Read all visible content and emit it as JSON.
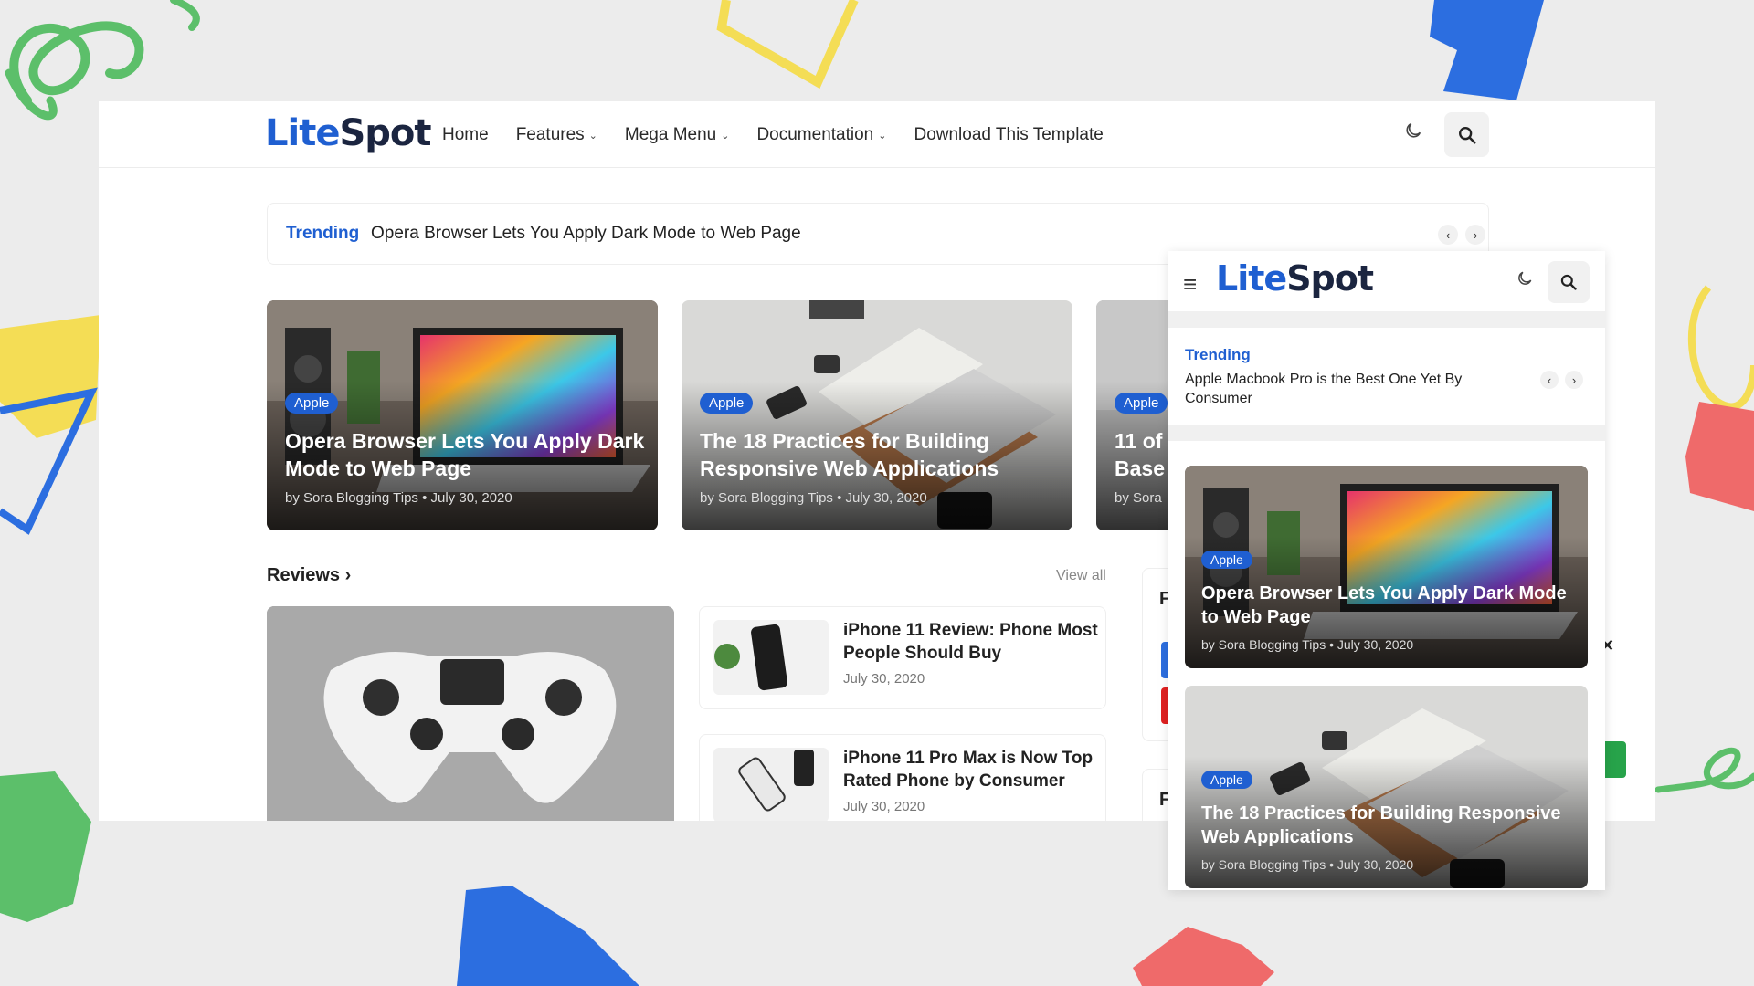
{
  "desktop": {
    "logo": {
      "part1": "Lite",
      "part2": "Spot"
    },
    "nav": [
      {
        "label": "Home",
        "dropdown": false
      },
      {
        "label": "Features",
        "dropdown": true
      },
      {
        "label": "Mega Menu",
        "dropdown": true
      },
      {
        "label": "Documentation",
        "dropdown": true
      },
      {
        "label": "Download This Template",
        "dropdown": false
      }
    ],
    "trending": {
      "label": "Trending",
      "title": "Opera Browser Lets You Apply Dark Mode to Web Page"
    },
    "cards": [
      {
        "tag": "Apple",
        "title": "Opera Browser Lets You Apply Dark Mode to Web Page",
        "meta": "by Sora Blogging Tips • July 30, 2020"
      },
      {
        "tag": "Apple",
        "title": "The 18 Practices for Building Responsive Web Applications",
        "meta": "by Sora Blogging Tips • July 30, 2020"
      },
      {
        "tag": "Apple",
        "title": "11 of Base",
        "meta": "by Sora"
      }
    ],
    "reviews": {
      "title": "Reviews",
      "view_all": "View all",
      "items": [
        {
          "title": "iPhone 11 Review: Phone Most People Should Buy",
          "date": "July 30, 2020"
        },
        {
          "title": "iPhone 11 Pro Max is Now Top Rated Phone by Consumer",
          "date": "July 30, 2020"
        }
      ]
    },
    "side_widget_letters": [
      "F",
      "F"
    ]
  },
  "mobile": {
    "logo": {
      "part1": "Lite",
      "part2": "Spot"
    },
    "trending": {
      "label": "Trending",
      "title": "Apple Macbook Pro is the Best One Yet By Consumer"
    },
    "cards": [
      {
        "tag": "Apple",
        "title": "Opera Browser Lets You Apply Dark Mode to Web Page",
        "meta": "by Sora Blogging Tips • July 30, 2020"
      },
      {
        "tag": "Apple",
        "title": "The 18 Practices for Building Responsive Web Applications",
        "meta": "by Sora Blogging Tips • July 30, 2020"
      }
    ]
  },
  "colors": {
    "accent": "#1f5fd1",
    "logo_dark": "#1b2540"
  },
  "icons": {
    "moon": "moon-icon",
    "search": "search-icon",
    "menu": "hamburger-icon",
    "close": "close-icon"
  }
}
